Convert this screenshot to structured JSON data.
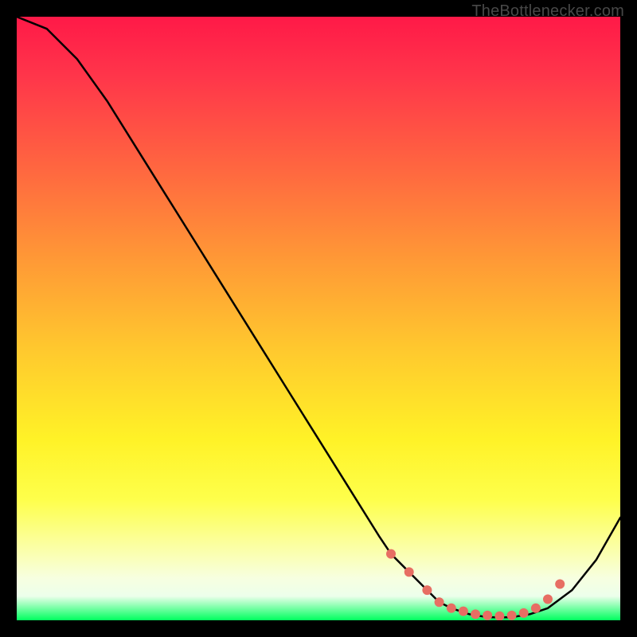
{
  "watermark_text": "TheBottlenecker.com",
  "chart_data": {
    "type": "line",
    "title": "",
    "xlabel": "",
    "ylabel": "",
    "xlim": [
      0,
      100
    ],
    "ylim": [
      0,
      100
    ],
    "series": [
      {
        "name": "bottleneck-curve",
        "x": [
          0,
          5,
          10,
          15,
          20,
          25,
          30,
          35,
          40,
          45,
          50,
          55,
          60,
          62,
          65,
          68,
          70,
          72,
          75,
          78,
          80,
          82,
          85,
          88,
          92,
          96,
          100
        ],
        "y": [
          100,
          98,
          93,
          86,
          78,
          70,
          62,
          54,
          46,
          38,
          30,
          22,
          14,
          11,
          8,
          5,
          3,
          2,
          1,
          0.5,
          0.5,
          0.5,
          1,
          2,
          5,
          10,
          17
        ]
      }
    ],
    "markers": {
      "name": "highlight-dots",
      "color": "#e76e63",
      "points": [
        {
          "x": 62,
          "y": 11
        },
        {
          "x": 65,
          "y": 8
        },
        {
          "x": 68,
          "y": 5
        },
        {
          "x": 70,
          "y": 3
        },
        {
          "x": 72,
          "y": 2
        },
        {
          "x": 74,
          "y": 1.5
        },
        {
          "x": 76,
          "y": 1
        },
        {
          "x": 78,
          "y": 0.8
        },
        {
          "x": 80,
          "y": 0.7
        },
        {
          "x": 82,
          "y": 0.8
        },
        {
          "x": 84,
          "y": 1.2
        },
        {
          "x": 86,
          "y": 2
        },
        {
          "x": 88,
          "y": 3.5
        },
        {
          "x": 90,
          "y": 6
        }
      ]
    }
  }
}
